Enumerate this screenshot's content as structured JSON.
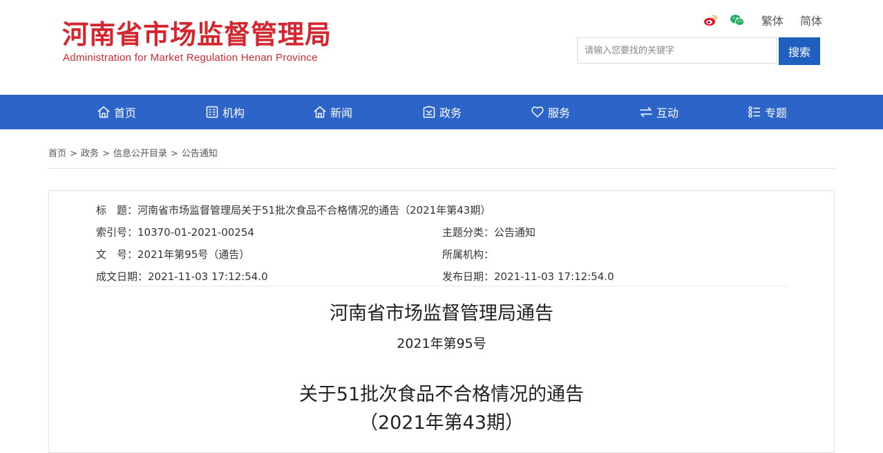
{
  "header": {
    "site_title": "河南省市场监督管理局",
    "site_subtitle": "Administration for Market Regulation Henan Province",
    "top_links": {
      "traditional": "繁体",
      "simplified": "简体"
    },
    "icons": {
      "weibo": "weibo-icon",
      "wechat": "wechat-icon"
    },
    "search": {
      "placeholder": "请输入您要找的关键字",
      "button_label": "搜索"
    }
  },
  "nav": {
    "items": [
      {
        "label": "首页",
        "icon": "home-icon"
      },
      {
        "label": "机构",
        "icon": "organization-icon"
      },
      {
        "label": "新闻",
        "icon": "news-icon"
      },
      {
        "label": "政务",
        "icon": "government-affairs-icon"
      },
      {
        "label": "服务",
        "icon": "heart-icon"
      },
      {
        "label": "互动",
        "icon": "exchange-icon"
      },
      {
        "label": "专题",
        "icon": "topics-list-icon"
      }
    ]
  },
  "breadcrumb": {
    "items": [
      "首页",
      "政务",
      "信息公开目录",
      "公告通知"
    ],
    "separator": ">"
  },
  "meta": {
    "title": "标　题：河南省市场监督管理局关于51批次食品不合格情况的通告（2021年第43期）",
    "index_no": "索引号：10370-01-2021-00254",
    "category": "主题分类：公告通知",
    "doc_no": "文　号：2021年第95号（通告）",
    "agency": "所属机构：",
    "created_date": "成文日期：2021-11-03 17:12:54.0",
    "published_date": "发布日期：2021-11-03 17:12:54.0"
  },
  "document": {
    "heading": "河南省市场监督管理局通告",
    "number": "2021年第95号",
    "subject_line1": "关于51批次食品不合格情况的通告",
    "subject_line2": "（2021年第43期）"
  },
  "colors": {
    "brand_red": "#d3262f",
    "nav_blue": "#2d64c7",
    "search_button_blue": "#1f5fbf",
    "weibo_red": "#e6162d",
    "wechat_green": "#2aae67"
  }
}
